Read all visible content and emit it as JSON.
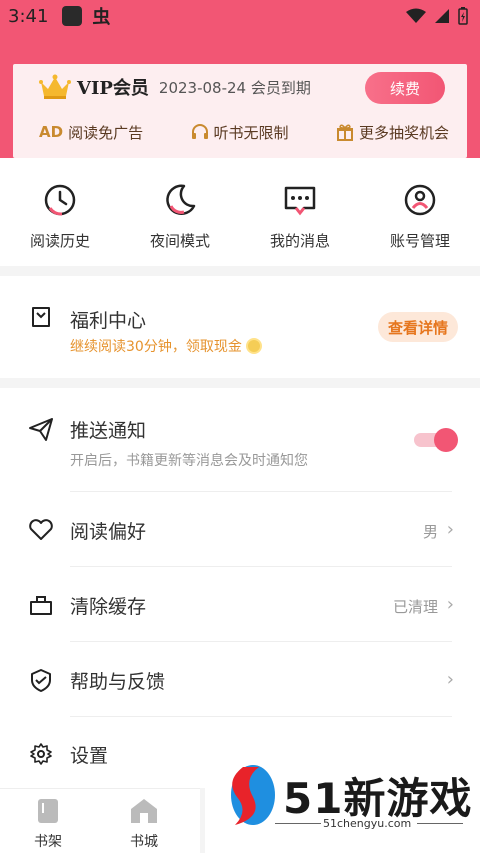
{
  "status_bar": {
    "time": "3:41"
  },
  "vip": {
    "title": "VIP会员",
    "expire": "2023-08-24 会员到期",
    "renew_label": "续费",
    "perks": [
      {
        "icon": "AD",
        "label": "阅读免广告"
      },
      {
        "icon": "headphones-icon",
        "label": "听书无限制"
      },
      {
        "icon": "gift-icon",
        "label": "更多抽奖机会"
      }
    ]
  },
  "quick_actions": [
    {
      "icon": "clock-icon",
      "label": "阅读历史"
    },
    {
      "icon": "moon-icon",
      "label": "夜间模式"
    },
    {
      "icon": "message-icon",
      "label": "我的消息"
    },
    {
      "icon": "account-icon",
      "label": "账号管理"
    }
  ],
  "welfare": {
    "title": "福利中心",
    "subtitle": "继续阅读30分钟，领取现金",
    "button_label": "查看详情"
  },
  "settings": {
    "push": {
      "title": "推送通知",
      "subtitle": "开启后，书籍更新等消息会及时通知您",
      "enabled": true
    },
    "reading_pref": {
      "title": "阅读偏好",
      "value": "男"
    },
    "clear_cache": {
      "title": "清除缓存",
      "value": "已清理"
    },
    "help": {
      "title": "帮助与反馈"
    },
    "settings": {
      "title": "设置"
    }
  },
  "tabbar": [
    {
      "icon": "bookshelf-icon",
      "label": "书架"
    },
    {
      "icon": "bookstore-icon",
      "label": "书城"
    }
  ],
  "watermark": {
    "text": "51新游戏",
    "url": "51chengyu.com"
  },
  "colors": {
    "accent": "#f25674",
    "orange": "#e6932e"
  }
}
